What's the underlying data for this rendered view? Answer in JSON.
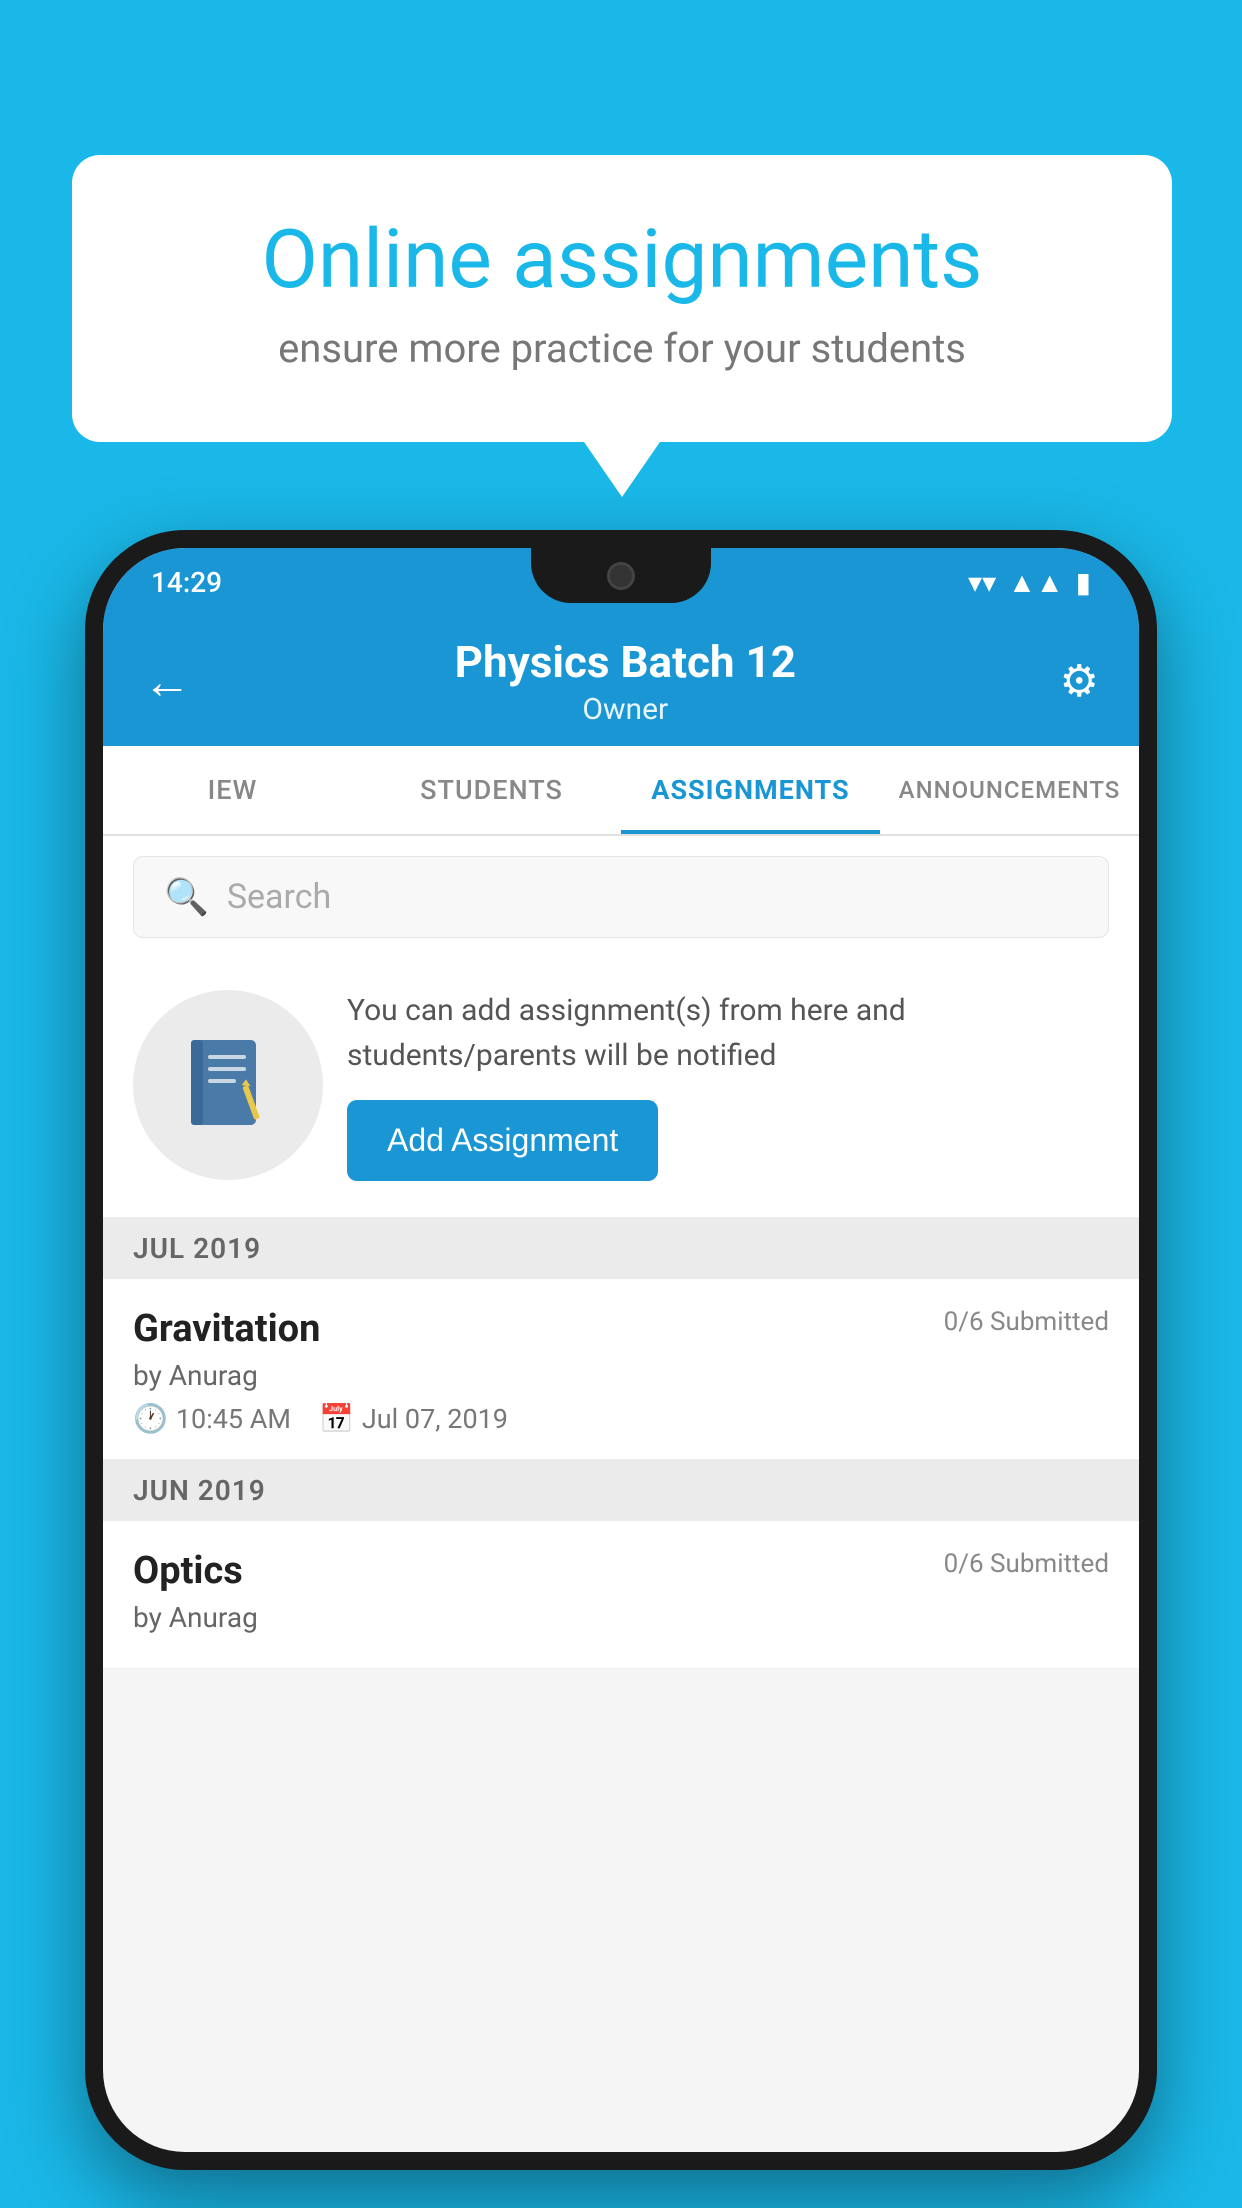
{
  "background_color": "#1ab8e8",
  "speech_bubble": {
    "title": "Online assignments",
    "subtitle": "ensure more practice for your students"
  },
  "status_bar": {
    "time": "14:29",
    "icons": [
      "wifi",
      "signal",
      "battery"
    ]
  },
  "app_header": {
    "title": "Physics Batch 12",
    "subtitle": "Owner",
    "back_label": "←",
    "gear_label": "⚙"
  },
  "tabs": [
    {
      "label": "IEW",
      "active": false
    },
    {
      "label": "STUDENTS",
      "active": false
    },
    {
      "label": "ASSIGNMENTS",
      "active": true
    },
    {
      "label": "ANNOUNCEMENTS",
      "active": false
    }
  ],
  "search": {
    "placeholder": "Search"
  },
  "promo": {
    "description": "You can add assignment(s) from here and students/parents will be notified",
    "button_label": "Add Assignment"
  },
  "assignment_groups": [
    {
      "month": "JUL 2019",
      "assignments": [
        {
          "title": "Gravitation",
          "submitted": "0/6 Submitted",
          "author": "by Anurag",
          "time": "10:45 AM",
          "date": "Jul 07, 2019"
        }
      ]
    },
    {
      "month": "JUN 2019",
      "assignments": [
        {
          "title": "Optics",
          "submitted": "0/6 Submitted",
          "author": "by Anurag",
          "time": "",
          "date": ""
        }
      ]
    }
  ]
}
